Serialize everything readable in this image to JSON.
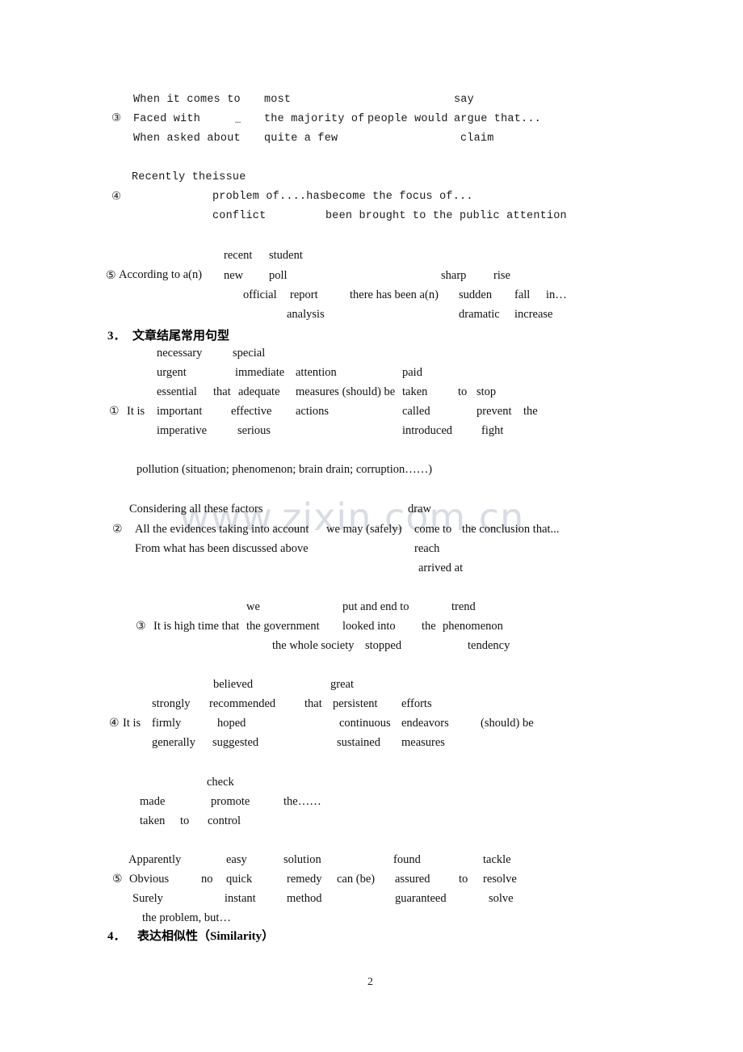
{
  "page": {
    "number": "2",
    "watermark": "www.zixin.com.cn",
    "watermark_color": "#d8dce4",
    "background_color": "#ffffff",
    "text_color": "#111111"
  },
  "blocks": {
    "pattern3": {
      "marker": "③",
      "ellipsis": "…",
      "col1": [
        "When it comes to",
        "Faced with",
        "When asked about"
      ],
      "col2": [
        "most",
        "the majority of",
        "quite a few"
      ],
      "col3": [
        "people would"
      ],
      "col4": [
        "say",
        "argue that...",
        "claim"
      ]
    },
    "pattern4": {
      "marker": "④",
      "col1": [
        "Recently the"
      ],
      "col2": [
        "issue",
        "problem of....has",
        "conflict"
      ],
      "col3": [
        "become the focus of...",
        "been brought to the public attention"
      ]
    },
    "pattern5": {
      "marker": "⑤",
      "lead": "According to a(n)",
      "col1": [
        "recent",
        "new",
        "official",
        "analysis"
      ],
      "col2": [
        "student",
        "poll",
        "report"
      ],
      "mid": "there has been a(n)",
      "col3": [
        "sharp",
        "sudden",
        "dramatic"
      ],
      "col4": [
        "rise",
        "fall",
        "increase"
      ],
      "tail": "in…"
    }
  },
  "section3": {
    "number": "3．",
    "title": "文章结尾常用句型",
    "item1": {
      "marker": "①",
      "lead": "It is",
      "col1": [
        "necessary",
        "urgent",
        "essential",
        "important",
        "imperative"
      ],
      "that": "that",
      "col2": [
        "special",
        "immediate",
        "adequate",
        "effective",
        "serious"
      ],
      "col3": [
        "attention",
        "measures (should) be",
        "actions"
      ],
      "col4": [
        "paid",
        "taken",
        "called",
        "introduced"
      ],
      "to": "to",
      "col5": [
        "stop",
        "prevent",
        "fight"
      ],
      "the": "the",
      "tail": "pollution (situation; phenomenon; brain drain; corruption……)"
    },
    "item2": {
      "marker": "②",
      "col1": [
        "Considering all these factors",
        "All the evidences taking into account",
        "From what has been discussed above"
      ],
      "col2": [
        "we may (safely)"
      ],
      "col3": [
        "draw",
        "come to",
        "reach",
        "arrived at"
      ],
      "col4": [
        "the conclusion that..."
      ]
    },
    "item3": {
      "marker": "③",
      "lead": "It is high time that",
      "col1": [
        "we",
        "the government",
        "the whole society"
      ],
      "col2": [
        "put and end to",
        "looked into",
        "stopped"
      ],
      "the": "the",
      "col3": [
        "trend",
        "phenomenon",
        "tendency"
      ]
    },
    "item4": {
      "marker": "④",
      "lead": "It is",
      "col1": [
        "strongly",
        "firmly",
        "generally"
      ],
      "col2": [
        "believed",
        "recommended",
        "hoped",
        "suggested"
      ],
      "that": "that",
      "col3": [
        "great",
        "persistent",
        "continuous",
        "sustained"
      ],
      "col4": [
        "efforts",
        "endeavors",
        "measures"
      ],
      "should_be": "(should) be",
      "col5": [
        "made",
        "taken"
      ],
      "to": "to",
      "col6": [
        "check",
        "promote",
        "control"
      ],
      "tail": "the……"
    },
    "item5": {
      "marker": "⑤",
      "col1": [
        "Apparently",
        "Obvious",
        "Surely"
      ],
      "no": "no",
      "col2": [
        "easy",
        "quick",
        "instant"
      ],
      "col3": [
        "solution",
        "remedy",
        "method"
      ],
      "canbe": "can (be)",
      "col4": [
        "found",
        "assured",
        "guaranteed"
      ],
      "to": "to",
      "col5": [
        "tackle",
        "resolve",
        "solve"
      ],
      "tail": "the problem, but…"
    }
  },
  "section4": {
    "number": "4．",
    "title": "表达相似性（Similarity）",
    "title_cjk": "表达相似性（",
    "title_latin": "Similarity",
    "title_close": "）"
  }
}
